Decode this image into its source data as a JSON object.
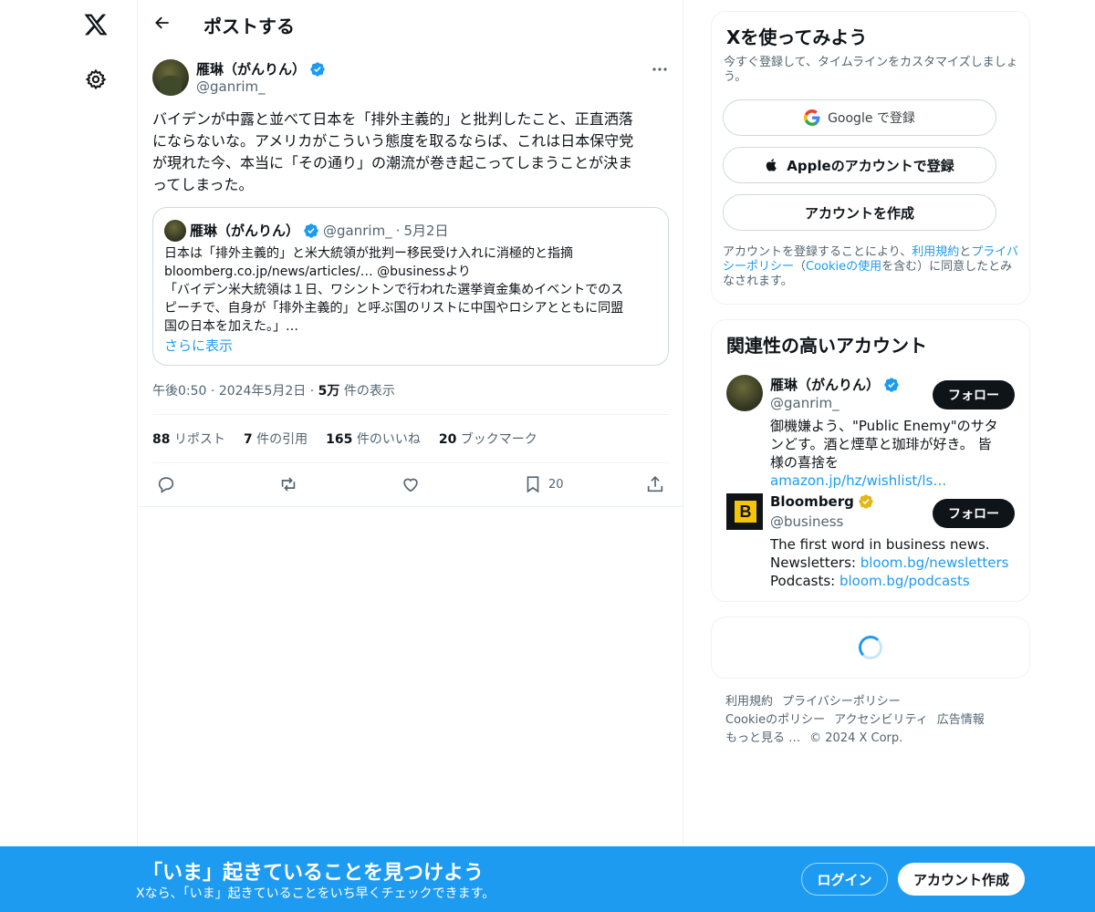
{
  "nav": {
    "logo_icon": "x-logo-icon",
    "settings_icon": "gear-icon"
  },
  "header": {
    "title": "ポストする"
  },
  "tweet": {
    "author_name": "雁琳（がんりん）",
    "author_handle": "@ganrim_",
    "text": "バイデンが中露と並べて日本を「排外主義的」と批判したこと、正直洒落\nにならないな。アメリカがこういう態度を取るならば、これは日本保守党\nが現れた今、本当に「その通り」の潮流が巻き起こってしまうことが決ま\nってしまった。",
    "quote": {
      "author_name": "雁琳（がんりん）",
      "author_handle": "@ganrim_",
      "date": "5月2日",
      "body": "日本は「排外主義的」と米大統領が批判ー移民受け入れに消極的と指摘\nbloomberg.co.jp/news/articles/… @businessより\n「バイデン米大統領は１日、ワシントンで行われた選挙資金集めイベントでのス\nピーチで、自身が「排外主義的」と呼ぶ国のリストに中国やロシアとともに同盟\n国の日本を加えた。」…",
      "show_more": "さらに表示"
    },
    "time": "午後0:50",
    "date": "2024年5月2日",
    "views_count": "5万",
    "views_label": "件の表示",
    "stats": [
      {
        "count": "88",
        "label": "リポスト"
      },
      {
        "count": "7",
        "label": "件の引用"
      },
      {
        "count": "165",
        "label": "件のいいね"
      },
      {
        "count": "20",
        "label": "ブックマーク"
      }
    ],
    "bookmark_count": "20"
  },
  "signup_card": {
    "title": "Xを使ってみよう",
    "subtitle": "今すぐ登録して、タイムラインをカスタマイズしましょう。",
    "google_label": "Google で登録",
    "apple_label": "Appleのアカウントで登録",
    "create_label": "アカウントを作成",
    "legal_prefix": "アカウントを登録することにより、",
    "legal_terms": "利用規約",
    "legal_and": "と",
    "legal_privacy": "プライバシーポリシー",
    "legal_open": "（",
    "legal_cookie": "Cookieの使用",
    "legal_suffix": "を含む）に同意したとみなされます。"
  },
  "relevant": {
    "title": "関連性の高いアカウント",
    "accounts": [
      {
        "name": "雁琳（がんりん）",
        "handle": "@ganrim_",
        "bio": "御機嫌よう、\"Public Enemy\"のサタンどす。酒と煙草と珈琲が好き。 皆様の喜捨を ",
        "bio_link": "amazon.jp/hz/wishlist/ls…",
        "follow": "フォロー",
        "badge_color": "#1d9bf0"
      },
      {
        "name": "Bloomberg",
        "handle": "@business",
        "bio_line1": "The first word in business news.",
        "bio_line2_prefix": "Newsletters: ",
        "bio_line2_link": "bloom.bg/newsletters",
        "bio_line3_prefix": "Podcasts: ",
        "bio_line3_link": "bloom.bg/podcasts",
        "follow": "フォロー",
        "badge_color": "#e2b719"
      }
    ]
  },
  "footer": {
    "terms": "利用規約",
    "privacy": "プライバシーポリシー",
    "cookie": "Cookieのポリシー",
    "accessibility": "アクセシビリティ",
    "ads": "広告情報",
    "more": "もっと見る …",
    "copyright": "© 2024 X Corp."
  },
  "banner": {
    "title": "「いま」起きていることを見つけよう",
    "subtitle": "Xなら、「いま」起きていることをいち早くチェックできます。",
    "login": "ログイン",
    "signup": "アカウント作成"
  },
  "colors": {
    "accent": "#1d9bf0",
    "text": "#0f1419",
    "muted": "#536471"
  }
}
